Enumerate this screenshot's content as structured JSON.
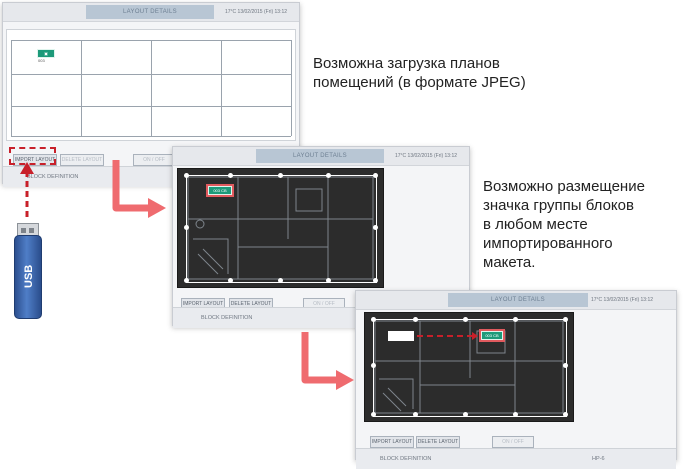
{
  "screens": [
    {
      "title_tab": "LAYOUT DETAILS",
      "status": "17°C  13/02/2015  (Fri)  13:12",
      "buttons": [
        "IMPORT LAYOUT",
        "DELETE LAYOUT",
        "ON / OFF"
      ],
      "footer": [
        "BLOCK DEFINITION"
      ],
      "icon_caption": "003"
    },
    {
      "title_tab": "LAYOUT DETAILS",
      "status": "17°C  13/02/2015  (Fri)  13:12",
      "buttons": [
        "IMPORT LAYOUT",
        "DELETE LAYOUT",
        "ON / OFF"
      ],
      "footer": [
        "BLOCK DEFINITION"
      ],
      "icon_label": "003 CB"
    },
    {
      "title_tab": "LAYOUT DETAILS",
      "status": "17°C  13/02/2015  (Fri)  13:12",
      "buttons": [
        "IMPORT LAYOUT",
        "DELETE LAYOUT",
        "ON / OFF"
      ],
      "footer": [
        "BLOCK DEFINITION",
        "",
        "HP-6"
      ],
      "icon_label": "003 CB"
    }
  ],
  "captions": {
    "import": "Возможна загрузка планов помещений (в формате JPEG)",
    "place_lines": [
      "Возможно размещение",
      "значка группы блоков",
      "в любом месте",
      "импортированного",
      "макета."
    ]
  },
  "usb": {
    "label": "USB"
  },
  "colors": {
    "arrow": "#ef6b6f",
    "dashed_arrow": "#c8202a",
    "icon": "#1d9a7a",
    "usb": "#3a64a8"
  }
}
